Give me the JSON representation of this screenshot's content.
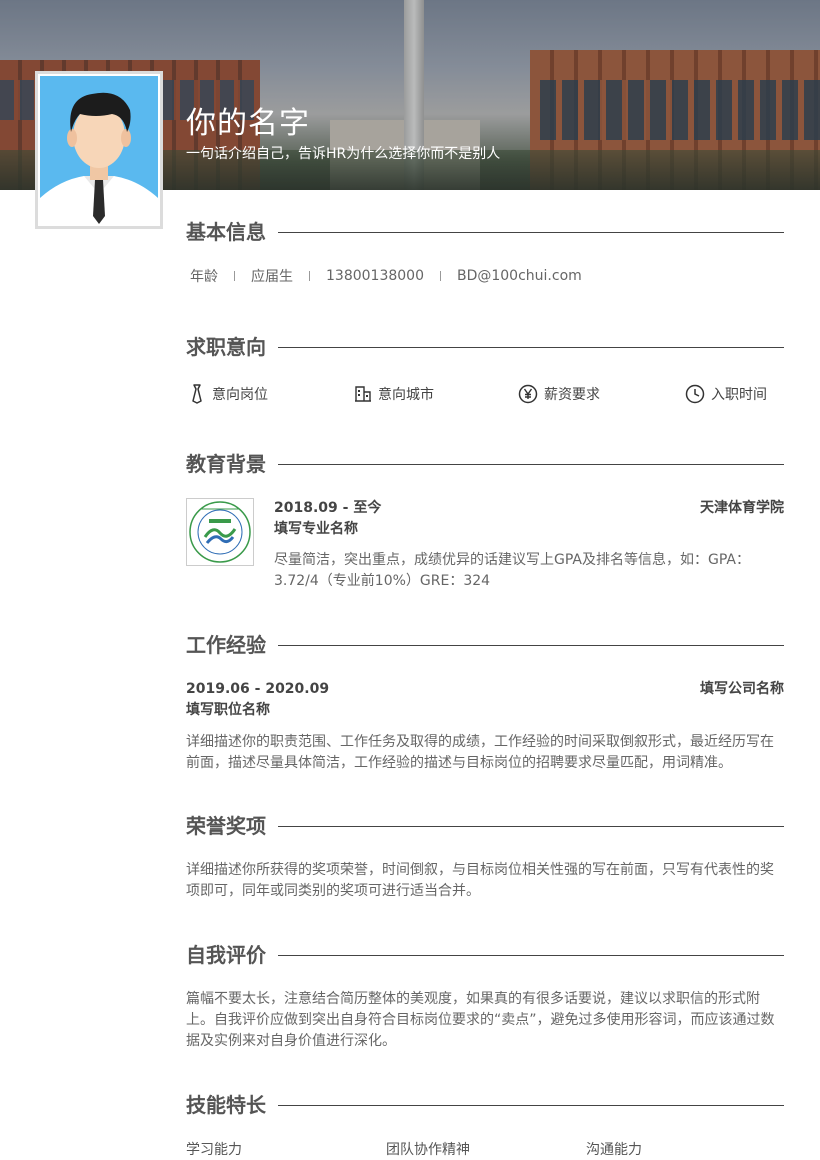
{
  "header": {
    "name": "你的名字",
    "tagline": "一句话介绍自己，告诉HR为什么选择你而不是别人"
  },
  "sections": {
    "basic": "基本信息",
    "intent": "求职意向",
    "education": "教育背景",
    "work": "工作经验",
    "honors": "荣誉奖项",
    "self": "自我评价",
    "skills": "技能特长"
  },
  "basic_info": {
    "age": "年龄",
    "status": "应届生",
    "phone": "13800138000",
    "email": "BD@100chui.com"
  },
  "intent": {
    "position": "意向岗位",
    "city": "意向城市",
    "salary": "薪资要求",
    "entry": "入职时间",
    "icons": [
      "tie-icon",
      "building-icon",
      "yen-icon",
      "clock-icon"
    ]
  },
  "education": {
    "period": "2018.09 - 至今",
    "school": "天津体育学院",
    "major": "填写专业名称",
    "desc": "尽量简洁，突出重点，成绩优异的话建议写上GPA及排名等信息，如：GPA：3.72/4（专业前10%）GRE：324"
  },
  "work": {
    "period": "2019.06 - 2020.09",
    "company": "填写公司名称",
    "title": "填写职位名称",
    "desc": "详细描述你的职责范围、工作任务及取得的成绩，工作经验的时间采取倒叙形式，最近经历写在前面，描述尽量具体简洁，工作经验的描述与目标岗位的招聘要求尽量匹配，用词精准。"
  },
  "honors": {
    "desc": "详细描述你所获得的奖项荣誉，时间倒叙，与目标岗位相关性强的写在前面，只写有代表性的奖项即可，同年或同类别的奖项可进行适当合并。"
  },
  "self_eval": {
    "desc": "篇幅不要太长，注意结合简历整体的美观度，如果真的有很多话要说，建议以求职信的形式附上。自我评价应做到突出自身符合目标岗位要求的“卖点”，避免过多使用形容词，而应该通过数据及实例来对自身价值进行深化。"
  },
  "skills": {
    "items": [
      "学习能力",
      "团队协作精神",
      "沟通能力"
    ]
  },
  "colors": {
    "avatar_bg": "#5ab9ef",
    "text": "#555555",
    "logo_green": "#3a9a4a",
    "logo_blue": "#2f6db5"
  }
}
